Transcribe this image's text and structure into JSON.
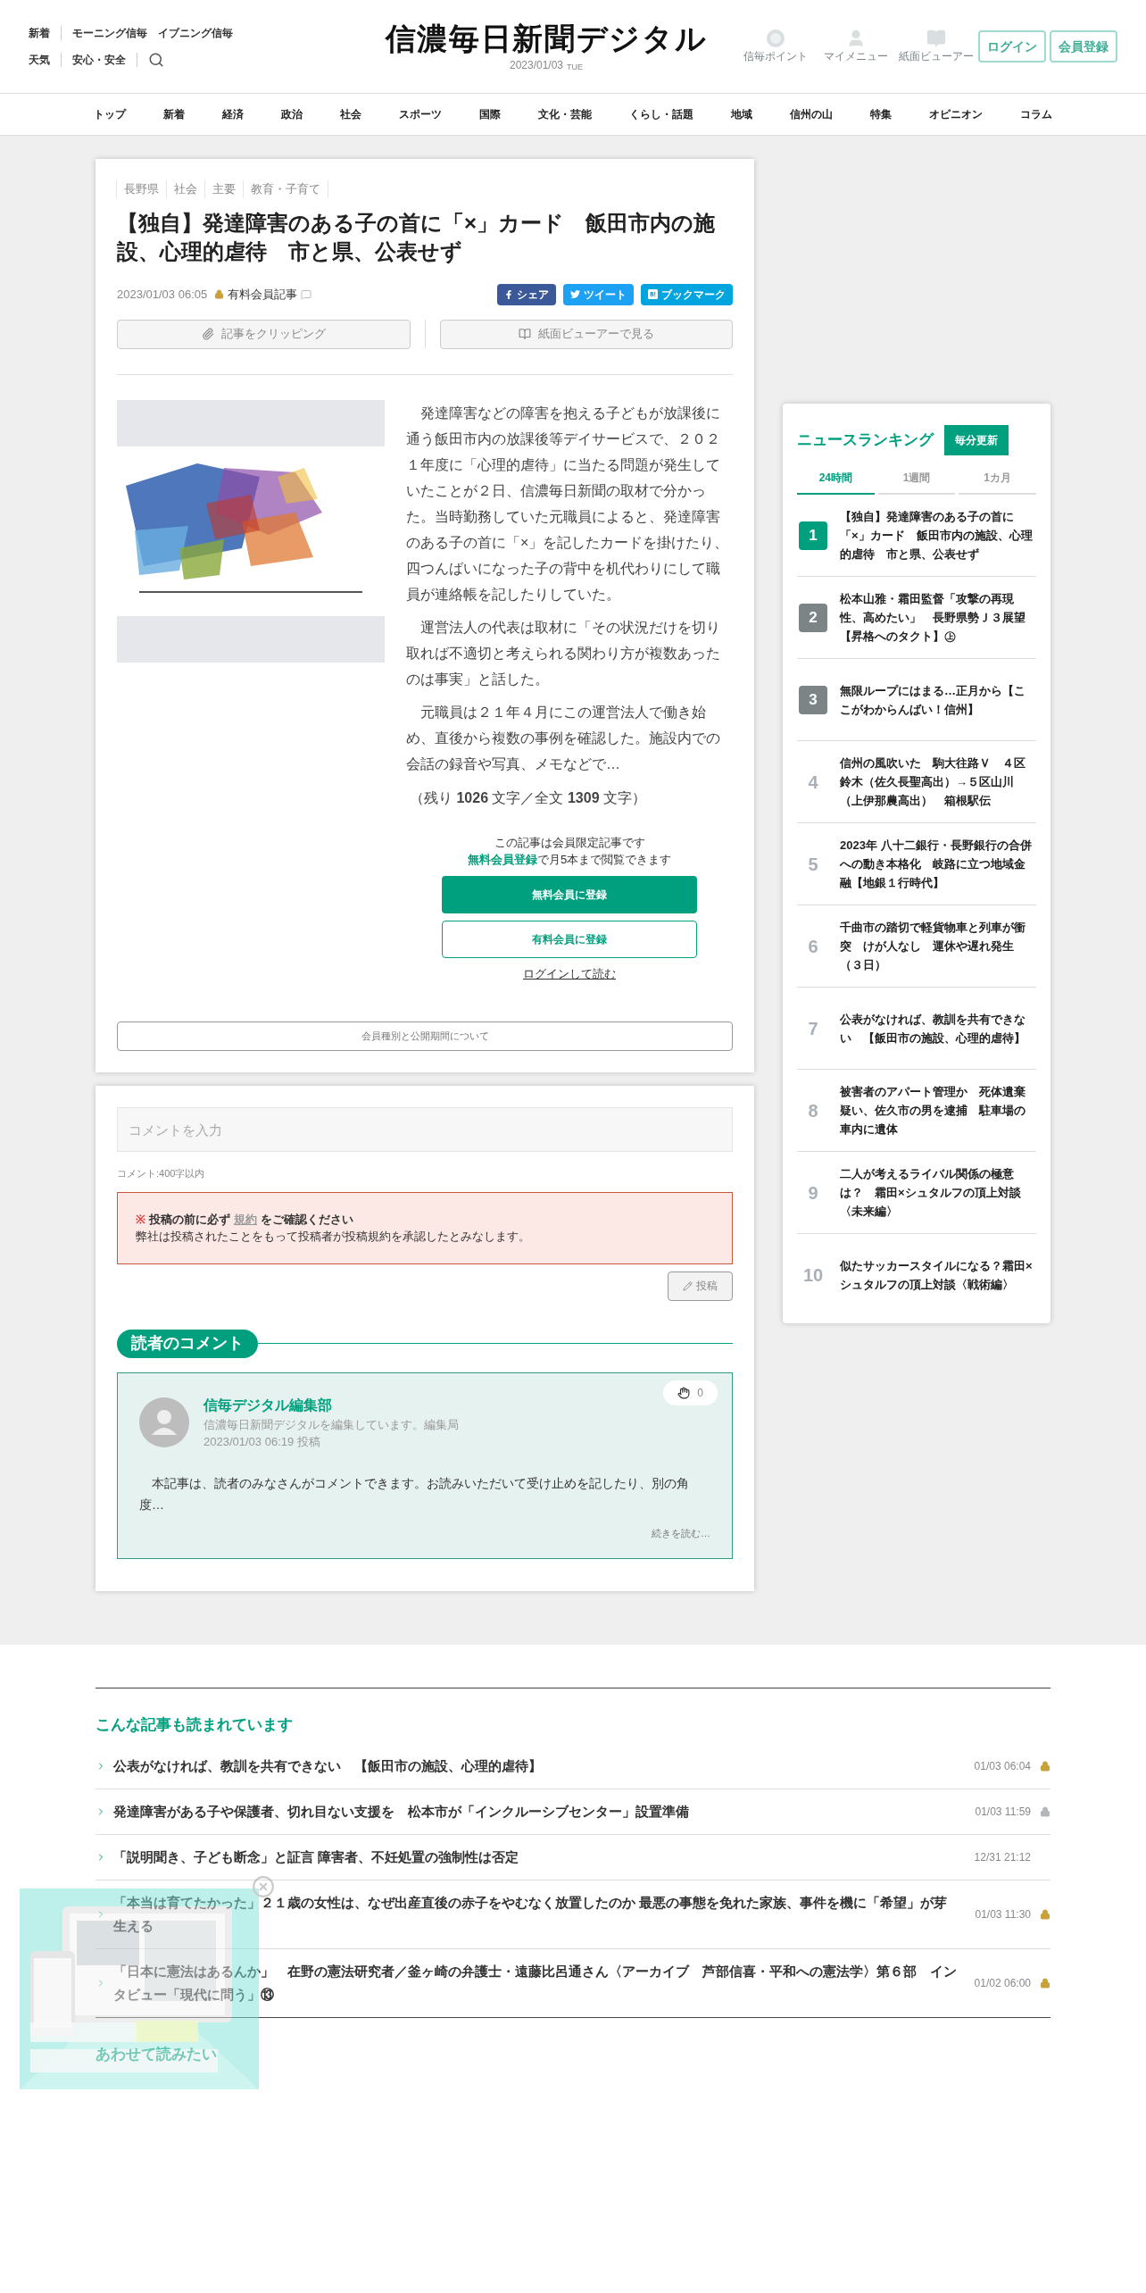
{
  "header": {
    "links_row1": [
      "新着",
      "モーニング信毎",
      "イブニング信毎"
    ],
    "links_row2": [
      "天気",
      "安心・安全"
    ],
    "logo": "信濃毎日新聞デジタル",
    "date": "2023/01/03",
    "weekday": "TUE",
    "icons": [
      {
        "kind": "points",
        "label": "信毎ポイント"
      },
      {
        "kind": "user",
        "label": "マイメニュー"
      },
      {
        "kind": "viewer",
        "label": "紙面ビューアー"
      }
    ],
    "buttons": [
      "ログイン",
      "会員登録"
    ]
  },
  "nav": [
    "トップ",
    "新着",
    "経済",
    "政治",
    "社会",
    "スポーツ",
    "国際",
    "文化・芸能",
    "くらし・話題",
    "地域",
    "信州の山",
    "特集",
    "オピニオン",
    "コラム"
  ],
  "article": {
    "tags": [
      "長野県",
      "社会",
      "主要",
      "教育・子育て"
    ],
    "title": "【独自】発達障害のある子の首に「×」カード　飯田市内の施設、心理的虐待　市と県、公表せず",
    "datetime": "2023/01/03 06:05",
    "badge": "有料会員記事",
    "share": [
      {
        "kind": "facebook",
        "label": "シェア"
      },
      {
        "kind": "twitter",
        "label": "ツイート"
      },
      {
        "kind": "hatena",
        "label": "ブックマーク"
      }
    ],
    "actions": [
      {
        "kind": "clip",
        "label": "記事をクリッピング"
      },
      {
        "kind": "viewer",
        "label": "紙面ビューアーで見る"
      }
    ],
    "image": {
      "kind": "picture"
    },
    "paragraphs": [
      "発達障害などの障害を抱える子どもが放課後に通う飯田市内の放課後等デイサービスで、２０２１年度に「心理的虐待」に当たる問題が発生していたことが２日、信濃毎日新聞の取材で分かった。当時勤務していた元職員によると、発達障害のある子の首に「×」を記したカードを掛けたり、四つんばいになった子の背中を机代わりにして職員が連絡帳を記したりしていた。",
      "運営法人の代表は取材に「その状況だけを切り取れば不適切と考えられる関わり方が複数あったのは事実」と話した。",
      "元職員は２１年４月にこの運営法人で働き始め、直後から複数の事例を確認した。施設内での会話の録音や写真、メモなどで…"
    ],
    "remaining": "（残り **1026** 文字／全文 **1309** 文字）",
    "paywall": {
      "notice": "この記事は会員限定記事です",
      "link": "無料会員登録",
      "notice2": "で月5本まで閲覧できます",
      "primary": "無料会員に登録",
      "secondary": "有料会員に登録",
      "login": "ログインして読む"
    },
    "membership_button": "会員種別と公開期間について"
  },
  "comments": {
    "placeholder": "コメントを入力",
    "limit": "コメント:400字以内",
    "notice_mark": "※",
    "notice_bold": "投稿の前に必ず",
    "notice_link": "規約",
    "notice_bold2": "をご確認ください",
    "notice_text": "弊社は投稿されたことをもって投稿者が投稿規約を承認したとみなします。",
    "post": "投稿",
    "section": "読者のコメント",
    "items": [
      {
        "author": "信毎デジタル編集部",
        "profile": "信濃毎日新聞デジタルを編集しています。編集局",
        "time": "2023/01/03 06:19 投稿",
        "likes": "0",
        "body": "本記事は、読者のみなさんがコメントできます。お読みいただいて受け止めを記したり、別の角度…",
        "more": "続きを読む…"
      }
    ]
  },
  "ranking": {
    "title": "ニュースランキング",
    "badge": "毎分更新",
    "tabs": [
      {
        "label": "24時間",
        "selected": true
      },
      {
        "label": "1週間",
        "selected": false
      },
      {
        "label": "1カ月",
        "selected": false
      }
    ],
    "items": [
      {
        "rank": "1",
        "kind": "badge",
        "color": "#00a07f",
        "title": "【独自】発達障害のある子の首に「×」カード　飯田市内の施設、心理的虐待　市と県、公表せず"
      },
      {
        "rank": "2",
        "kind": "badge",
        "color": "#7d8486",
        "title": "松本山雅・霜田監督「攻撃の再現性、高めたい」　長野県勢Ｊ３展望【昇格へのタクト】㊤"
      },
      {
        "rank": "3",
        "kind": "badge",
        "color": "#7d8486",
        "title": "無限ループにはまる…正月から【ここがわからんばい！信州】"
      },
      {
        "rank": "4",
        "kind": "plain",
        "title": "信州の風吹いた　駒大往路Ｖ　４区鈴木（佐久長聖高出）→５区山川（上伊那農高出）　箱根駅伝"
      },
      {
        "rank": "5",
        "kind": "plain",
        "title": "2023年 八十二銀行・長野銀行の合併への動き本格化　岐路に立つ地域金融【地銀１行時代】"
      },
      {
        "rank": "6",
        "kind": "plain",
        "title": "千曲市の踏切で軽貨物車と列車が衝突　けが人なし　運休や遅れ発生（３日）"
      },
      {
        "rank": "7",
        "kind": "plain",
        "title": "公表がなければ、教訓を共有できない　【飯田市の施設、心理的虐待】"
      },
      {
        "rank": "8",
        "kind": "plain",
        "title": "被害者のアパート管理か　死体遺棄疑い、佐久市の男を逮捕　駐車場の車内に遺体"
      },
      {
        "rank": "9",
        "kind": "plain",
        "title": "二人が考えるライバル関係の極意は？　霜田×シュタルフの頂上対談〈未来編〉"
      },
      {
        "rank": "10",
        "kind": "plain",
        "title": "似たサッカースタイルになる？霜田×シュタルフの頂上対談〈戦術編〉"
      }
    ]
  },
  "related": {
    "title": "こんな記事も読まれています",
    "items": [
      {
        "title": "公表がなければ、教訓を共有できない　【飯田市の施設、心理的虐待】",
        "time": "01/03 06:04",
        "locked": true,
        "color": "#c9a13b"
      },
      {
        "title": "発達障害がある子や保護者、切れ目ない支援を　松本市が「インクルーシブセンター」設置準備",
        "time": "01/03 11:59",
        "locked": true,
        "color": "#b3b7b9"
      },
      {
        "title": "「説明聞き、子ども断念」と証言 障害者、不妊処置の強制性は否定",
        "time": "12/31 21:12",
        "locked": false
      },
      {
        "title": "「本当は育てたかった」２１歳の女性は、なぜ出産直後の赤子をやむなく放置したのか 最悪の事態を免れた家族、事件を機に「希望」が芽生える",
        "time": "01/03 11:30",
        "locked": true,
        "color": "#c9a13b"
      },
      {
        "title": "「日本に憲法はあるんか」　在野の憲法研究者／釜ヶ崎の弁護士・遠藤比呂通さん〈アーカイブ　芦部信喜・平和への憲法学〉第６部　インタビュー「現代に問う」⑬",
        "time": "01/02 06:00",
        "locked": true,
        "color": "#c9a13b"
      }
    ]
  },
  "also_read": "あわせて読みたい",
  "ad": {
    "kind": "picture"
  }
}
